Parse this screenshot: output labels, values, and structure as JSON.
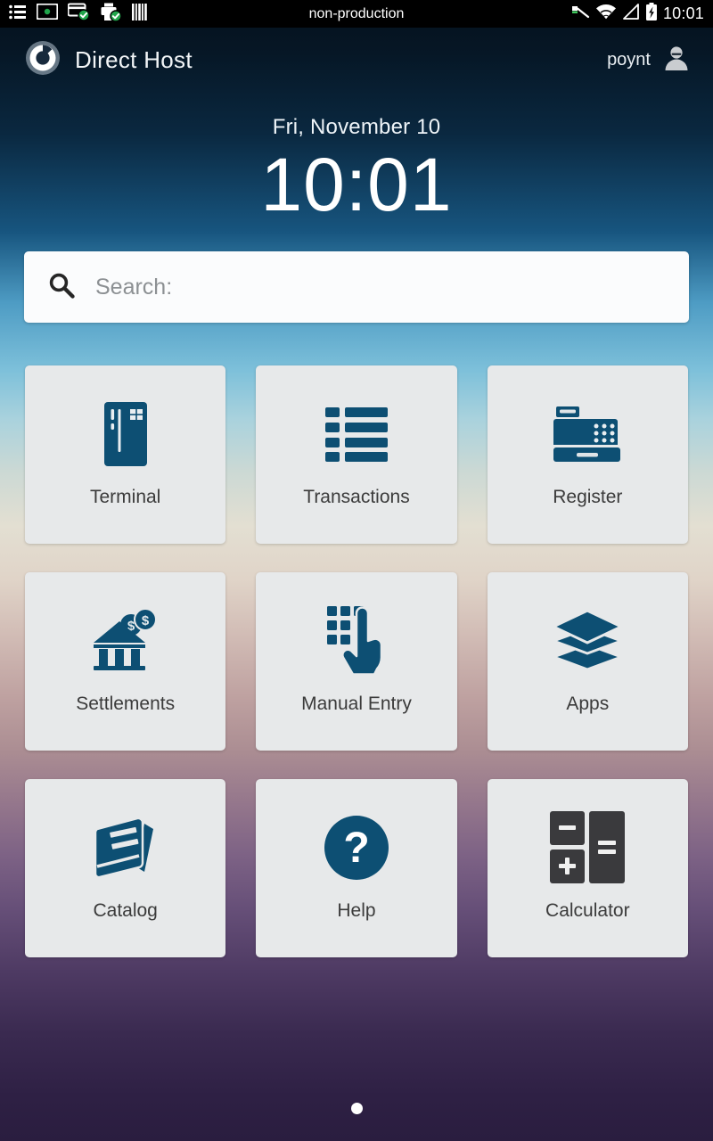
{
  "status_bar": {
    "title": "non-production",
    "clock": "10:01",
    "left_icons": [
      {
        "name": "list-status-icon",
        "label": "list"
      },
      {
        "name": "card-reader-status-icon",
        "label": "card reader connected"
      },
      {
        "name": "card-status-icon",
        "label": "card ok"
      },
      {
        "name": "printer-status-icon",
        "label": "printer ok"
      },
      {
        "name": "barcode-status-icon",
        "label": "barcode scanner"
      }
    ],
    "right_icons": [
      {
        "name": "vpn-key-status-icon",
        "label": "vpn"
      },
      {
        "name": "wifi-status-icon",
        "label": "wifi"
      },
      {
        "name": "signal-status-icon",
        "label": "cellular signal"
      },
      {
        "name": "battery-charging-status-icon",
        "label": "battery charging"
      }
    ]
  },
  "app_bar": {
    "logo_name": "poynt-logo-icon",
    "title": "Direct Host",
    "account_name": "poynt",
    "avatar_name": "account-avatar-icon"
  },
  "clock_widget": {
    "date": "Fri, November 10",
    "time": "10:01"
  },
  "search": {
    "icon": "search-icon",
    "placeholder": "Search:",
    "value": ""
  },
  "tiles": [
    {
      "label": "Terminal",
      "icon": "credit-card-icon"
    },
    {
      "label": "Transactions",
      "icon": "transaction-list-icon"
    },
    {
      "label": "Register",
      "icon": "cash-register-icon"
    },
    {
      "label": "Settlements",
      "icon": "bank-coins-icon"
    },
    {
      "label": "Manual Entry",
      "icon": "keypad-hand-icon"
    },
    {
      "label": "Apps",
      "icon": "layers-icon"
    },
    {
      "label": "Catalog",
      "icon": "book-icon"
    },
    {
      "label": "Help",
      "icon": "question-circle-icon"
    },
    {
      "label": "Calculator",
      "icon": "calculator-keys-icon"
    }
  ],
  "page_indicator": {
    "pages": 1,
    "active_page": 1
  },
  "colors": {
    "icon_blue": "#0d4f73",
    "tile_bg": "#e7e9ea",
    "status_ok_green": "#21a54b",
    "calculator_key": "#3a3a3d"
  }
}
